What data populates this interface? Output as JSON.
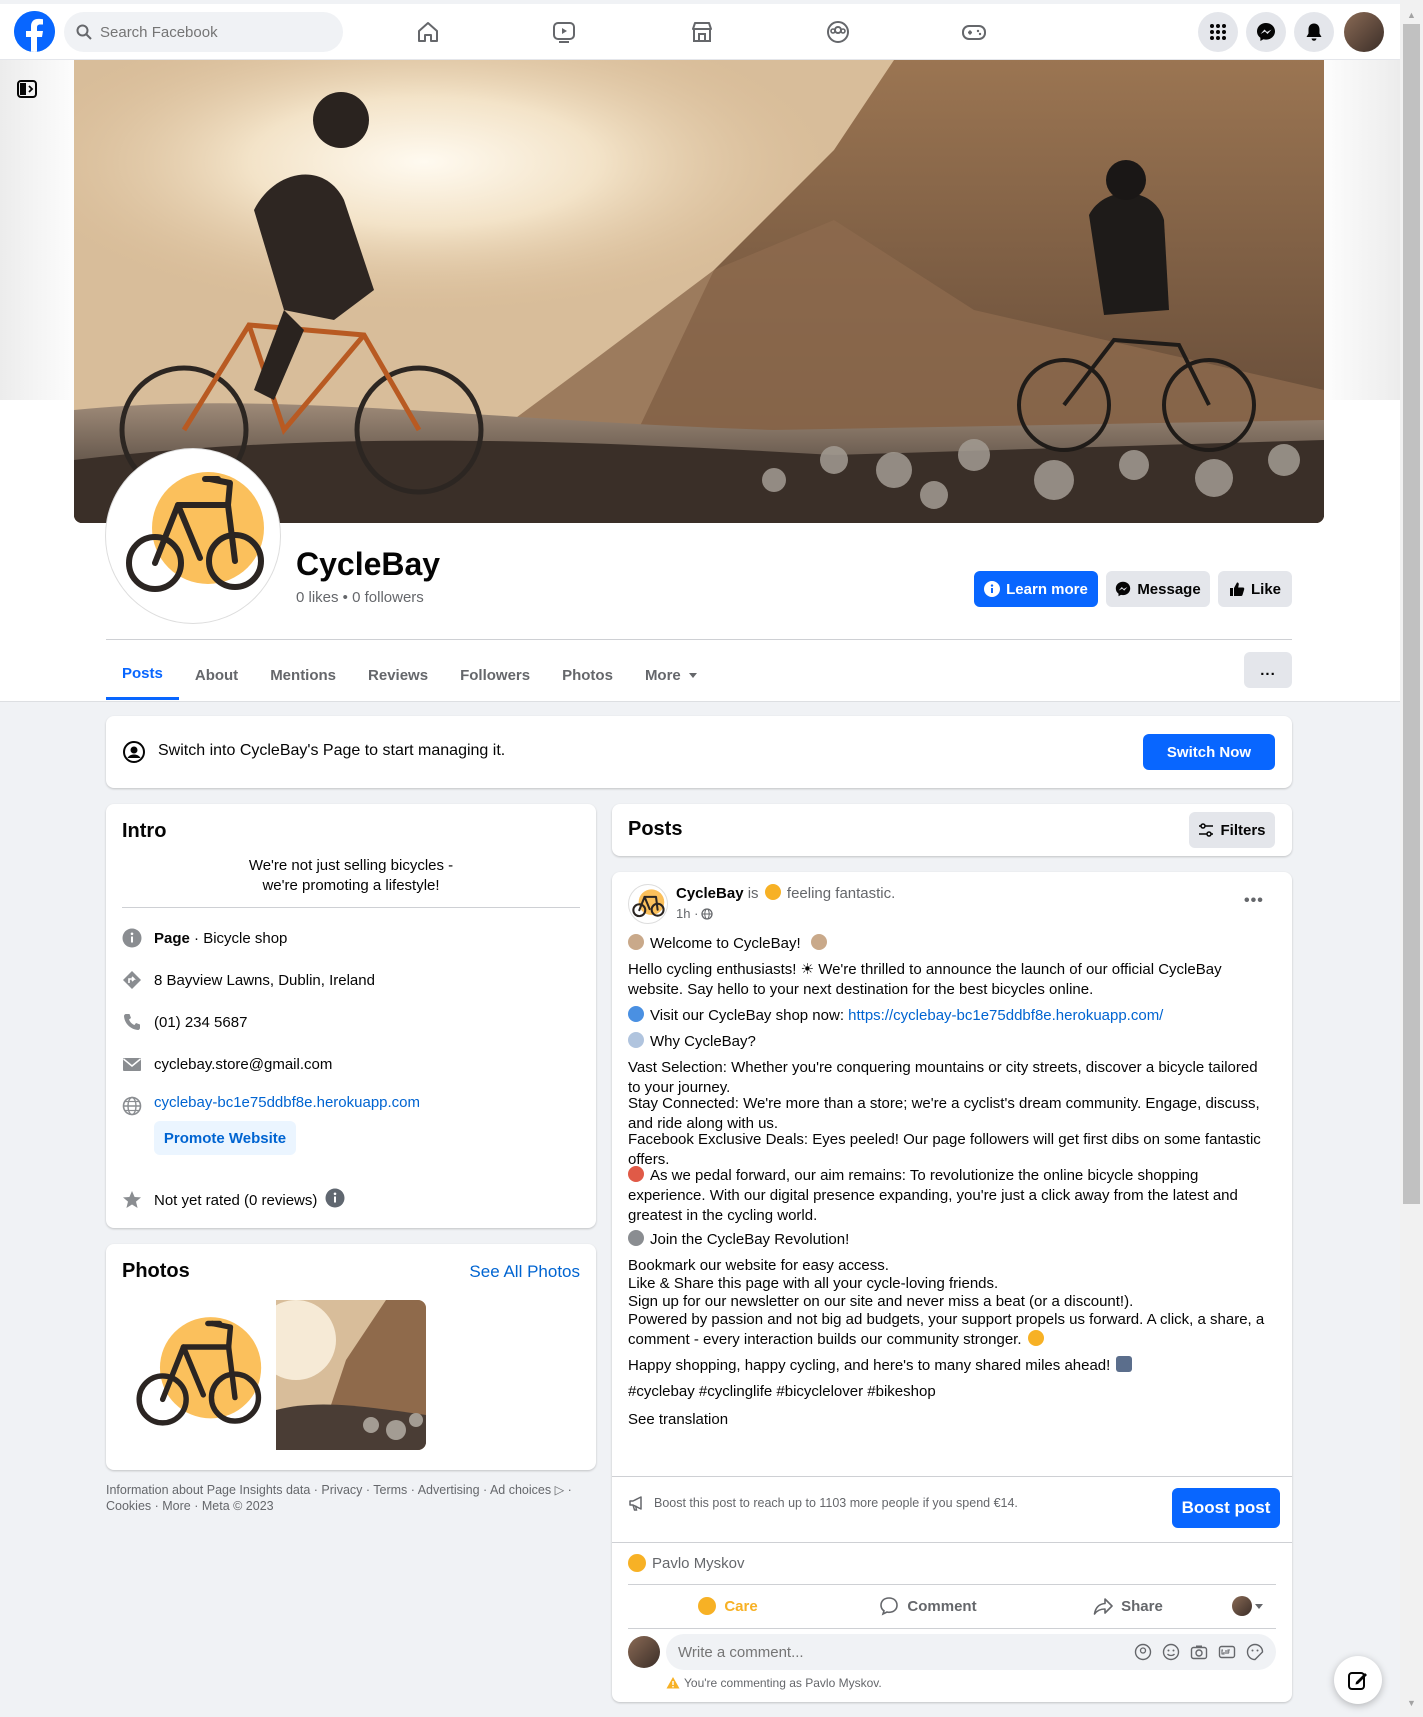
{
  "topbar": {
    "search_placeholder": "Search Facebook",
    "nav_icons": [
      "home-icon",
      "watch-icon",
      "marketplace-icon",
      "groups-icon",
      "gaming-icon"
    ],
    "right_icons": [
      "menu-grid-icon",
      "messenger-icon",
      "notifications-icon",
      "account-avatar"
    ]
  },
  "page": {
    "name": "CycleBay",
    "stats": "0 likes • 0 followers",
    "actions": {
      "learn_more": "Learn more",
      "message": "Message",
      "like": "Like"
    },
    "tabs": [
      "Posts",
      "About",
      "Mentions",
      "Reviews",
      "Followers",
      "Photos",
      "More"
    ],
    "active_tab": "Posts",
    "more_options": "..."
  },
  "switch_banner": {
    "text": "Switch into CycleBay's Page to start managing it.",
    "button": "Switch Now"
  },
  "intro": {
    "title": "Intro",
    "bio": "We're not just selling bicycles - we're promoting a lifestyle!",
    "category_label": "Page",
    "category_value": " · Bicycle shop",
    "address": "8 Bayview Lawns, Dublin, Ireland",
    "phone": "(01) 234 5687",
    "email": "cyclebay.store@gmail.com",
    "website": "cyclebay-bc1e75ddbf8e.herokuapp.com",
    "promote_button": "Promote Website",
    "rating": "Not yet rated (0 reviews)"
  },
  "photos": {
    "title": "Photos",
    "see_all": "See All Photos"
  },
  "footer": {
    "text": "Information about Page Insights data · Privacy · Terms · Advertising · Ad choices ▷ · Cookies · More · Meta © 2023"
  },
  "posts_header": {
    "title": "Posts",
    "filters": "Filters"
  },
  "post": {
    "author": "CycleBay",
    "is": "is",
    "feeling": "feeling fantastic.",
    "time": "1h ·",
    "welcome": "Welcome to CycleBay!",
    "p1": "Hello cycling enthusiasts! ☀ We're thrilled to announce the launch of our official CycleBay website. Say hello to your next destination for the best bicycles online.",
    "visit_prefix": "Visit our CycleBay shop now: ",
    "visit_link": "https://cyclebay-bc1e75ddbf8e.herokuapp.com/",
    "why": "Why CycleBay?",
    "p_vast": "Vast Selection: Whether you're conquering mountains or city streets, discover a bicycle tailored to your journey.",
    "p_stay": "Stay Connected: We're more than a store; we're a cyclist's dream community. Engage, discuss, and ride along with us.",
    "p_deals": "Facebook Exclusive Deals: Eyes peeled! Our page followers will get first dibs on some fantastic offers.",
    "p_pedal": "As we pedal forward, our aim remains: To revolutionize the online bicycle shopping experience. With our digital presence expanding, you're just a click away from the latest and greatest in the cycling world.",
    "join": "Join the CycleBay Revolution!",
    "p_bookmark": "Bookmark our website for easy access.",
    "p_like": "Like & Share this page with all your cycle-loving friends.",
    "p_signup": "Sign up for our newsletter on our site and never miss a beat (or a discount!).",
    "p_powered": "Powered by passion and not big ad budgets, your support propels us forward. A click, a share, a comment - every interaction builds our community stronger.",
    "p_happy": "Happy shopping, happy cycling, and here's to many shared miles ahead!",
    "hashtags": "#cyclebay #cyclinglife #bicyclelover #bikeshop",
    "see_translation": "See translation",
    "boost_text": "Boost this post to reach up to 1103 more people if you spend €14.",
    "boost_button": "Boost post",
    "reactor": "Pavlo Myskov",
    "care": "Care",
    "comment": "Comment",
    "share": "Share",
    "comment_placeholder": "Write a comment...",
    "commenting_as": "You're commenting as Pavlo Myskov."
  },
  "colors": {
    "brand_blue": "#0866ff",
    "care_yellow": "#f7b125",
    "logo_yellow": "#fbc05c"
  }
}
